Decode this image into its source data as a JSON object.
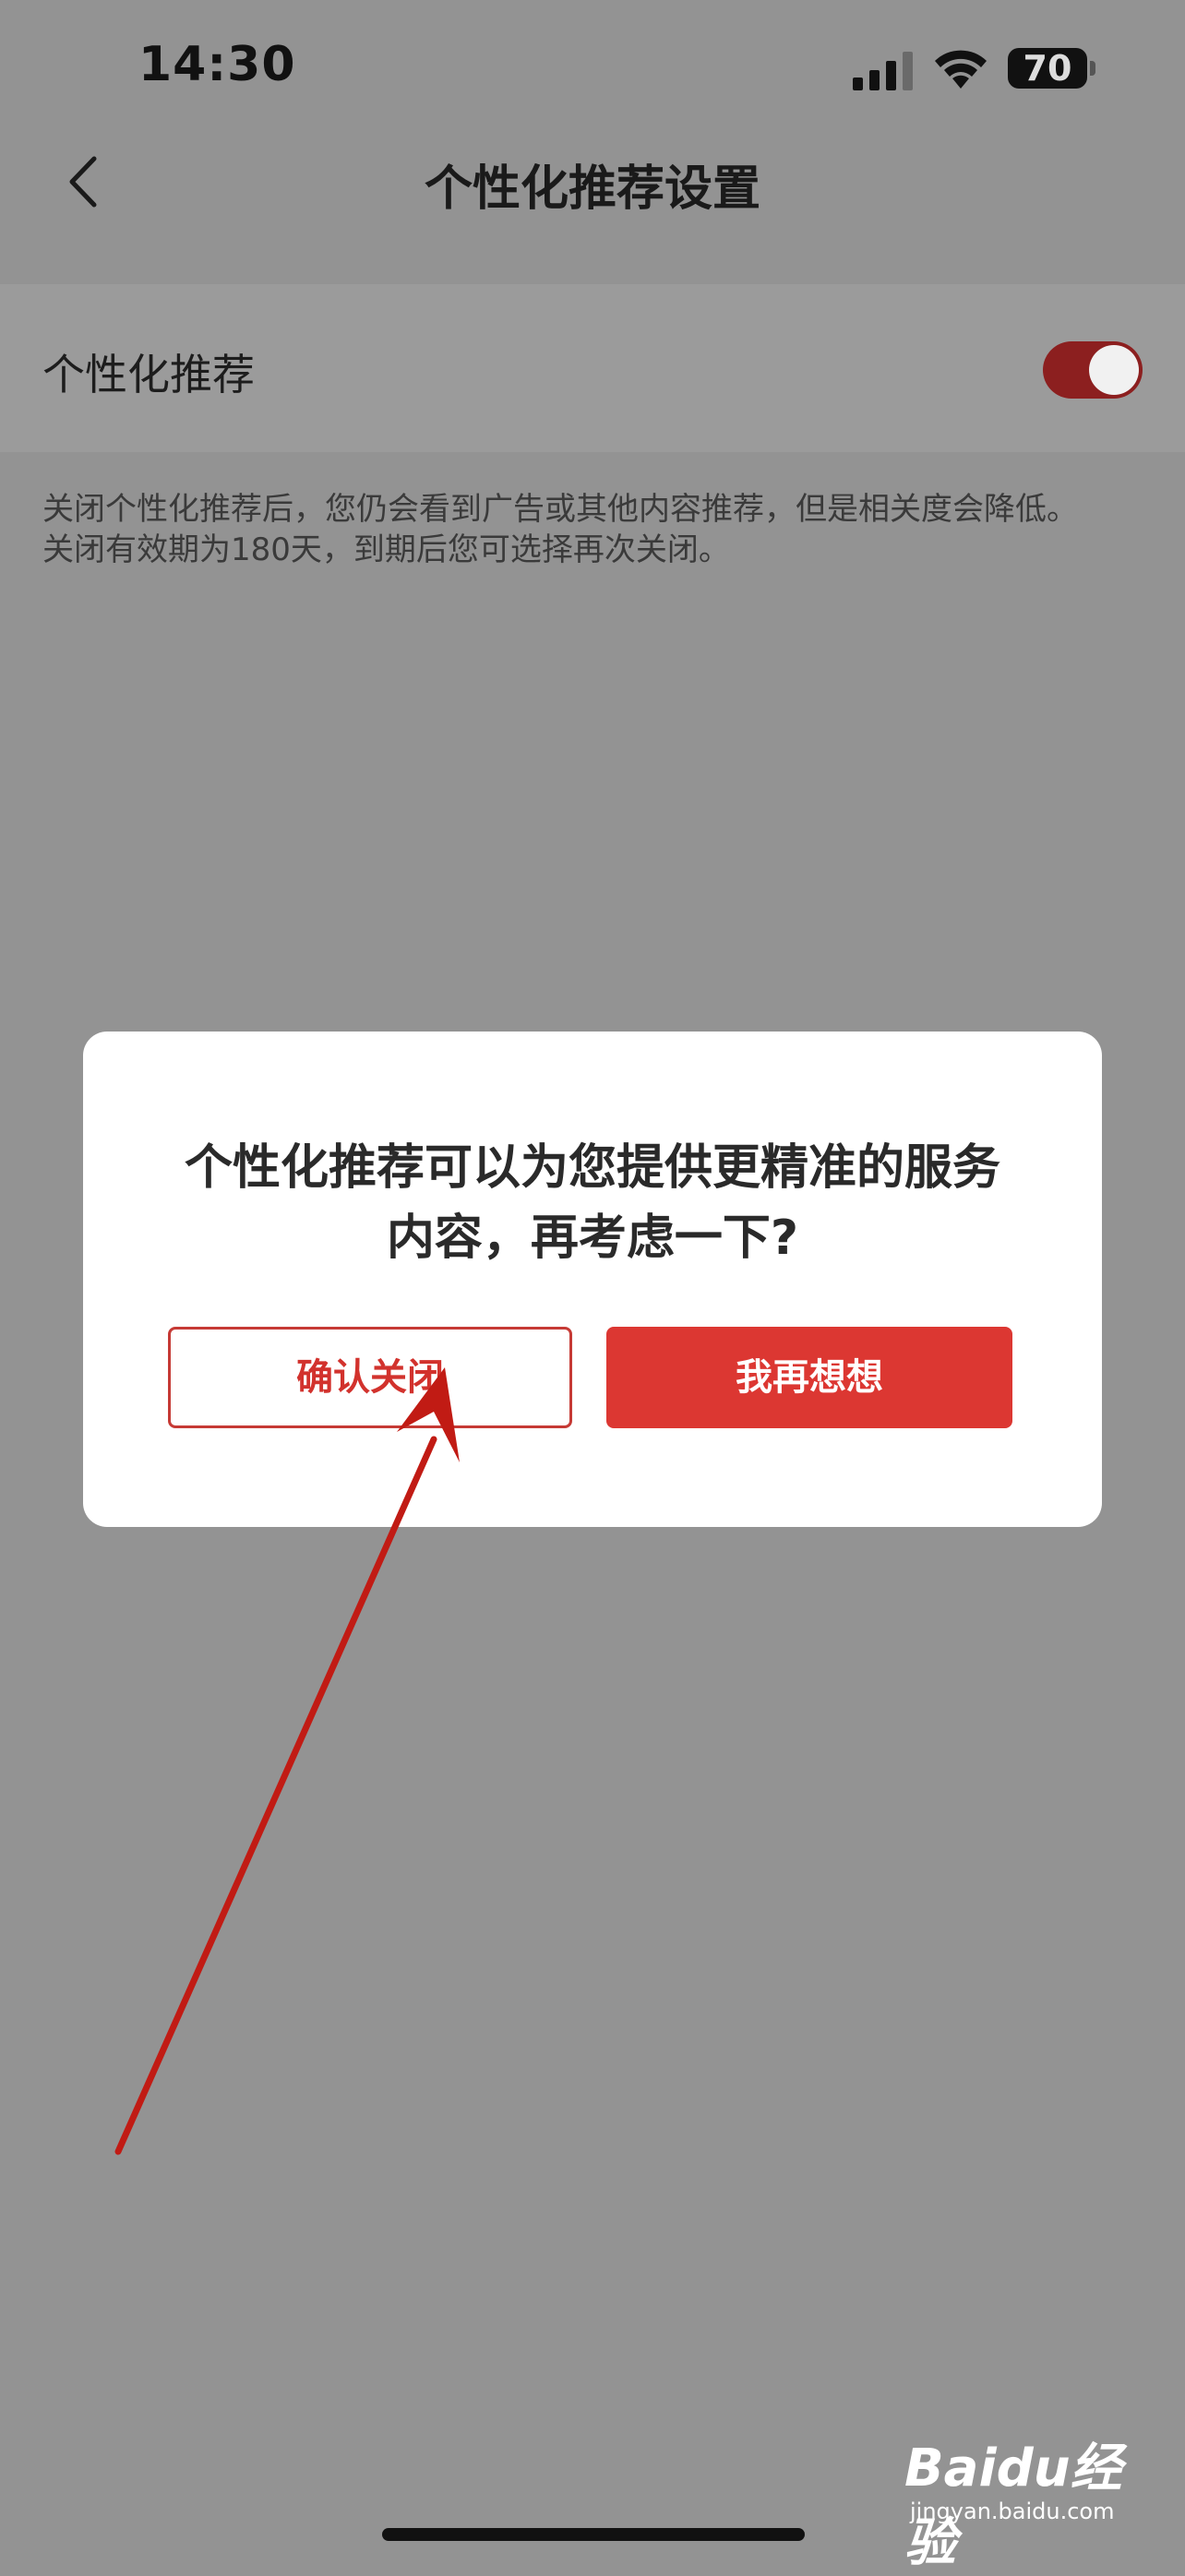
{
  "status_bar": {
    "time": "14:30",
    "battery_level": "70",
    "signal_icon": "signal-bars-icon",
    "wifi_icon": "wifi-icon"
  },
  "nav": {
    "back_icon": "chevron-left-icon",
    "title": "个性化推荐设置"
  },
  "setting": {
    "label": "个性化推荐",
    "toggle_on": true,
    "toggle_color": "#8c1f1f"
  },
  "description": {
    "line1": "关闭个性化推荐后，您仍会看到广告或其他内容推荐，但是相关度会降低。",
    "line2": "关闭有效期为180天，到期后您可选择再次关闭。"
  },
  "dialog": {
    "message_line1": "个性化推荐可以为您提供更精准的服务",
    "message_line2": "内容，再考虑一下?",
    "confirm_label": "确认关闭",
    "rethink_label": "我再想想",
    "accent_color": "#dc3732"
  },
  "watermark": {
    "brand": "Baidu经验",
    "url": "jingyan.baidu.com"
  }
}
